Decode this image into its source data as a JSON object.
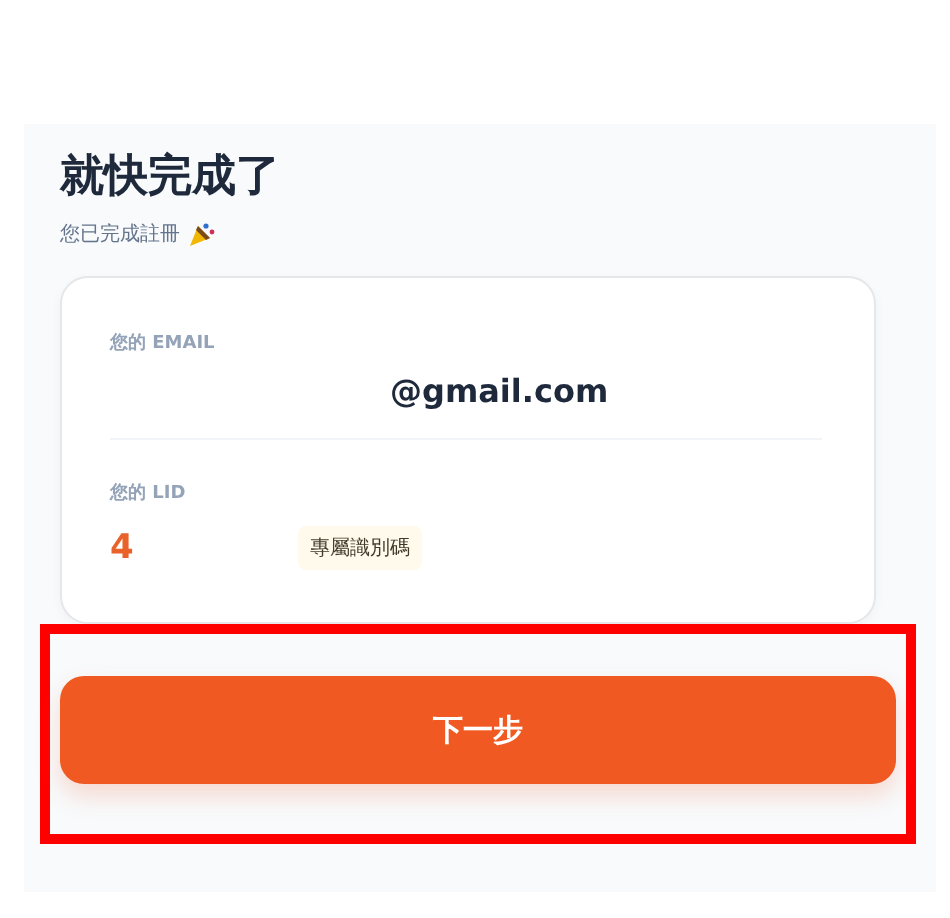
{
  "title": "就快完成了",
  "subtitle": "您已完成註冊",
  "email": {
    "label": "您的 EMAIL",
    "value": "@gmail.com"
  },
  "lid": {
    "label": "您的 LID",
    "value": "4",
    "badge": "專屬識別碼"
  },
  "next_button": {
    "label": "下一步"
  }
}
